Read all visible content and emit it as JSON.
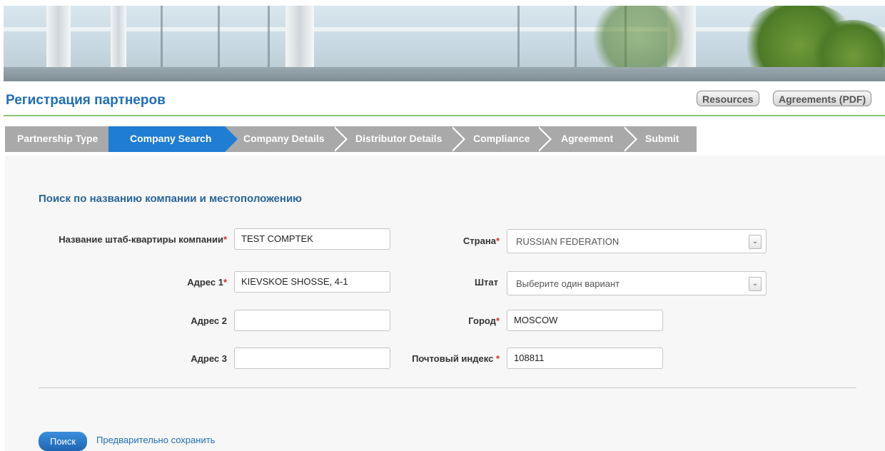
{
  "header": {
    "title": "Регистрация партнеров",
    "resources_label": "Resources",
    "agreements_label": "Agreements (PDF)"
  },
  "steps": [
    {
      "label": "Partnership Type",
      "active": false
    },
    {
      "label": "Company Search",
      "active": true
    },
    {
      "label": "Company Details",
      "active": false
    },
    {
      "label": "Distributor Details",
      "active": false
    },
    {
      "label": "Compliance",
      "active": false
    },
    {
      "label": "Agreement",
      "active": false
    },
    {
      "label": "Submit",
      "active": false
    }
  ],
  "form": {
    "section_title": "Поиск по названию компании и местоположению",
    "required_mark": "*",
    "company_hq": {
      "label": "Название штаб-квартиры компании",
      "value": "TEST COMPTEK",
      "required": true
    },
    "address1": {
      "label": "Адрес 1",
      "value": "KIEVSKOE SHOSSE, 4-1",
      "required": true
    },
    "address2": {
      "label": "Адрес 2",
      "value": "",
      "required": false
    },
    "address3": {
      "label": "Адрес 3",
      "value": "",
      "required": false
    },
    "country": {
      "label": "Страна",
      "value": "RUSSIAN FEDERATION",
      "required": true
    },
    "state": {
      "label": "Штат",
      "value": "Выберите один вариант",
      "required": false
    },
    "city": {
      "label": "Город",
      "value": "MOSCOW",
      "required": true
    },
    "postal": {
      "label": "Почтовый индекс ",
      "value": "108811",
      "required": true
    }
  },
  "actions": {
    "search_label": "Поиск",
    "presave_label": "Предварительно сохранить"
  },
  "colors": {
    "brand_blue": "#1f6eb6",
    "step_active": "#1f7dd3",
    "step_inactive": "#a9a9a9",
    "title_rule": "#8dc279",
    "required": "#d43030"
  },
  "icons": {
    "select_arrow": "chevron-down-icon"
  }
}
